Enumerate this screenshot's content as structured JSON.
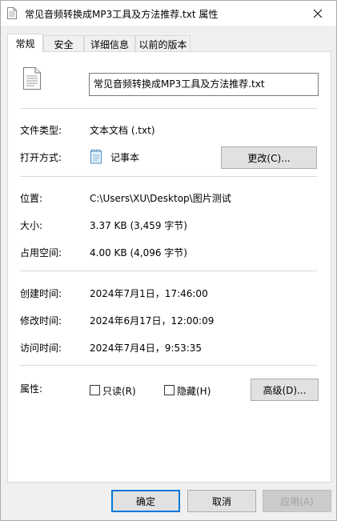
{
  "window": {
    "title": "常见音频转换成MP3工具及方法推荐.txt 属性"
  },
  "tabs": [
    {
      "label": "常规",
      "active": true
    },
    {
      "label": "安全",
      "active": false
    },
    {
      "label": "详细信息",
      "active": false
    },
    {
      "label": "以前的版本",
      "active": false
    }
  ],
  "general": {
    "filename": "常见音频转换成MP3工具及方法推荐.txt",
    "file_type_label": "文件类型:",
    "file_type_value": "文本文档 (.txt)",
    "open_with_label": "打开方式:",
    "open_with_value": "记事本",
    "change_button": "更改(C)...",
    "location_label": "位置:",
    "location_value": "C:\\Users\\XU\\Desktop\\图片测试",
    "size_label": "大小:",
    "size_value": "3.37 KB (3,459 字节)",
    "disk_size_label": "占用空间:",
    "disk_size_value": "4.00 KB (4,096 字节)",
    "created_label": "创建时间:",
    "created_value": "2024年7月1日，17:46:00",
    "modified_label": "修改时间:",
    "modified_value": "2024年6月17日，12:00:09",
    "accessed_label": "访问时间:",
    "accessed_value": "2024年7月4日，9:53:35",
    "attributes_label": "属性:",
    "readonly_label": "只读(R)",
    "readonly_checked": false,
    "hidden_label": "隐藏(H)",
    "hidden_checked": false,
    "advanced_button": "高级(D)..."
  },
  "footer": {
    "ok": "确定",
    "cancel": "取消",
    "apply": "应用(A)"
  },
  "colors": {
    "accent": "#0078d7",
    "panel_border": "#d9d9d9"
  }
}
